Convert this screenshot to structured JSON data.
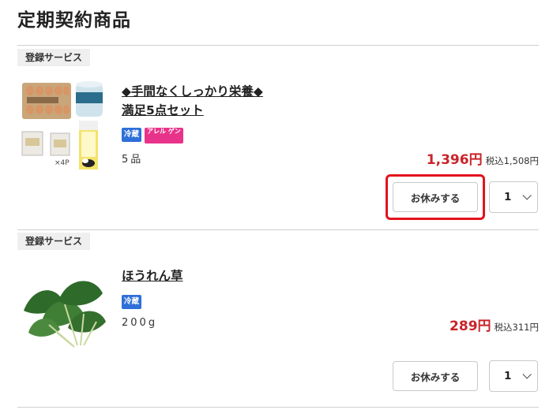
{
  "page": {
    "title": "定期契約商品"
  },
  "items": [
    {
      "badge": "登録サービス",
      "title_line1": "◆手間なくしっかり栄養◆",
      "title_line2": "満足5点セット",
      "tags": [
        "冷蔵",
        "アレル ゲン"
      ],
      "image_label": "×4P",
      "quantity_text": "5品",
      "price": "1,396円",
      "price_tax": "税込1,508円",
      "pause_label": "お休みする",
      "qty_value": "1"
    },
    {
      "badge": "登録サービス",
      "title_line1": "ほうれん草",
      "tags": [
        "冷蔵"
      ],
      "quantity_text": "200g",
      "price": "289円",
      "price_tax": "税込311円",
      "pause_label": "お休みする",
      "qty_value": "1"
    }
  ],
  "colors": {
    "price": "#c8242a",
    "tag_cold": "#2f6fd9",
    "tag_allergy": "#e8338a",
    "highlight": "#e3121c"
  }
}
